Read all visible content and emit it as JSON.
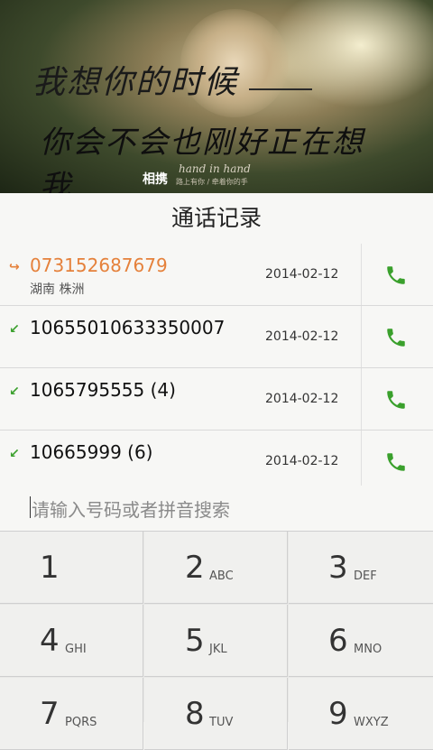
{
  "banner": {
    "line1": "我想你的时候",
    "line2": "你会不会也刚好正在想我……",
    "tag_main": "相携",
    "tag_en": "hand in hand",
    "tag_small": "路上有你 / 牵着你的手"
  },
  "header": {
    "title": "通话记录"
  },
  "calls": [
    {
      "number": "073152687679",
      "location": "湖南 株洲",
      "date": "2014-02-12",
      "direction_icon": "outgoing-call-arrow",
      "style": "missed-orange"
    },
    {
      "number": "10655010633350007",
      "location": "",
      "date": "2014-02-12",
      "direction_icon": "incoming-call-arrow",
      "style": "normal"
    },
    {
      "number": "1065795555 (4)",
      "location": "",
      "date": "2014-02-12",
      "direction_icon": "incoming-call-arrow",
      "style": "normal"
    },
    {
      "number": "10665999 (6)",
      "location": "",
      "date": "2014-02-12",
      "direction_icon": "incoming-call-arrow",
      "style": "normal"
    }
  ],
  "search": {
    "placeholder": "请输入号码或者拼音搜索"
  },
  "keypad": [
    {
      "digit": "1",
      "letters": ""
    },
    {
      "digit": "2",
      "letters": "ABC"
    },
    {
      "digit": "3",
      "letters": "DEF"
    },
    {
      "digit": "4",
      "letters": "GHI"
    },
    {
      "digit": "5",
      "letters": "JKL"
    },
    {
      "digit": "6",
      "letters": "MNO"
    },
    {
      "digit": "7",
      "letters": "PQRS"
    },
    {
      "digit": "8",
      "letters": "TUV"
    },
    {
      "digit": "9",
      "letters": "WXYZ"
    }
  ],
  "colors": {
    "accent_orange": "#e5813b",
    "call_green": "#3aa02c"
  }
}
